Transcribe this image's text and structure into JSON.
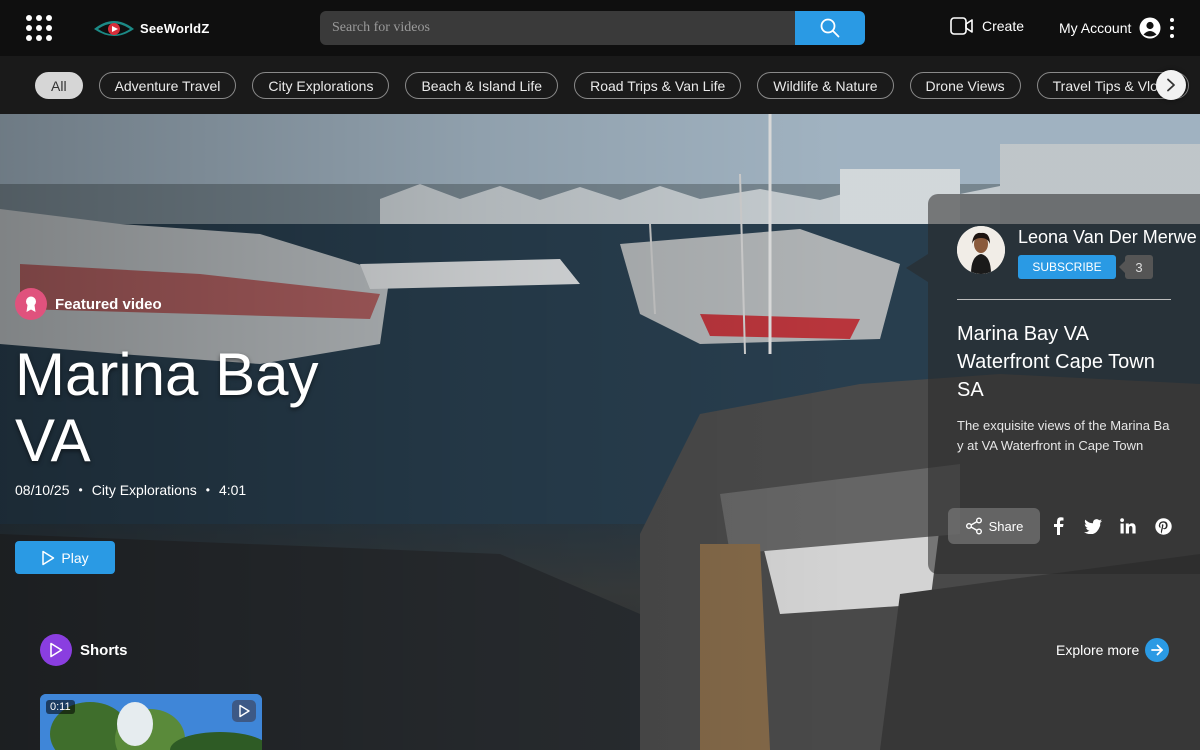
{
  "brand": {
    "name": "SeeWorldZ",
    "accent": "#2a9ae4"
  },
  "header": {
    "apps_icon": "grid-dots-icon",
    "search_placeholder": "Search for videos",
    "search_icon": "search-icon",
    "create_label": "Create",
    "account_label": "My Account"
  },
  "categories": {
    "items": [
      "All",
      "Adventure Travel",
      "City Explorations",
      "Beach & Island Life",
      "Road Trips & Van Life",
      "Wildlife & Nature",
      "Drone Views",
      "Travel Tips & Vlogs"
    ],
    "selected": "All"
  },
  "hero": {
    "featured_label": "Featured video",
    "title": "Marina Bay VA",
    "date": "08/10/25",
    "category": "City Explorations",
    "duration": "4:01",
    "play_label": "Play"
  },
  "card": {
    "channel_name": "Leona Van Der Merwe",
    "subscribe_label": "SUBSCRIBE",
    "subscriber_count": "3",
    "video_title": "Marina Bay VA Waterfront Cape Town SA",
    "video_description": "The exquisite views of the Marina Bay at VA Waterfront in Cape Town",
    "share_label": "Share",
    "social": [
      "facebook-icon",
      "twitter-icon",
      "linkedin-icon",
      "pinterest-icon"
    ]
  },
  "shorts": {
    "label": "Shorts",
    "explore_label": "Explore more",
    "items": [
      {
        "duration": "0:11"
      }
    ]
  }
}
